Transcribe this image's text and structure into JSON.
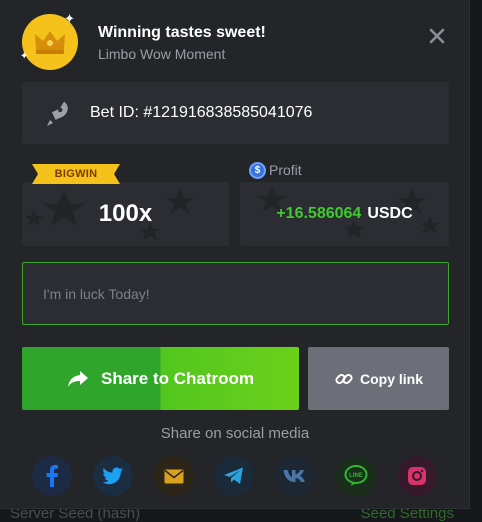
{
  "header": {
    "title": "Winning tastes sweet!",
    "subtitle": "Limbo Wow Moment"
  },
  "bet": {
    "label": "Bet ID: #121916838585041076"
  },
  "bigwin": {
    "badge": "BIGWIN",
    "multiplier": "100x"
  },
  "profit": {
    "label": "Profit",
    "amount": "+16.586064",
    "currency": "USDC"
  },
  "message": {
    "placeholder": "I'm in luck Today!"
  },
  "buttons": {
    "share": "Share to Chatroom",
    "copy": "Copy link"
  },
  "social": {
    "label": "Share on social media",
    "networks": [
      {
        "name": "facebook-icon",
        "color": "#1877f2"
      },
      {
        "name": "twitter-icon",
        "color": "#1da1f2"
      },
      {
        "name": "mail-icon",
        "color": "#d9a21e"
      },
      {
        "name": "telegram-icon",
        "color": "#2aa3e0"
      },
      {
        "name": "vk-icon",
        "color": "#4a76a8"
      },
      {
        "name": "line-icon",
        "color": "#2fb82f"
      },
      {
        "name": "instagram-icon",
        "color": "#d9336b"
      }
    ]
  },
  "background": {
    "left_text": "Server Seed (hash)",
    "right_text": "Seed Settings"
  },
  "colors": {
    "accent_green": "#3fcb2d",
    "badge_gold": "#f4c21b"
  }
}
